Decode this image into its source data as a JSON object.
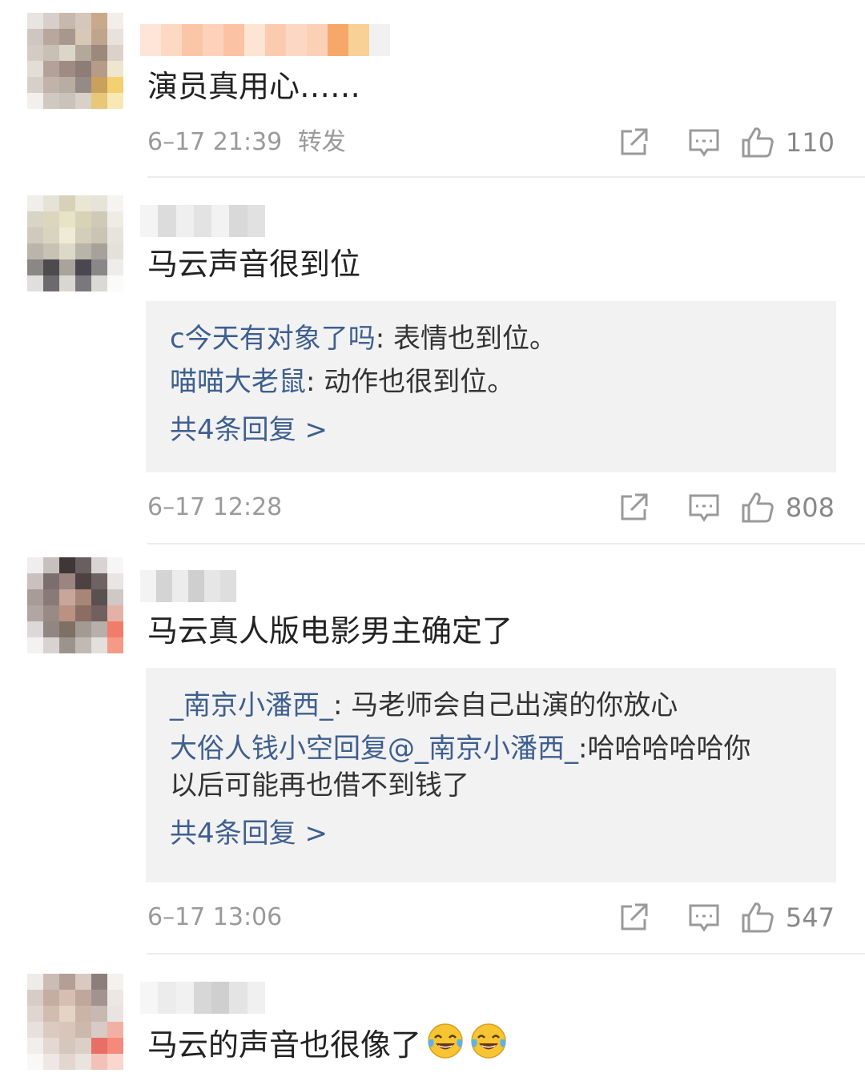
{
  "comments": [
    {
      "text": "演员真用心……",
      "time": "6–17 21:39",
      "extra": "转发",
      "likes": "110",
      "replies": null
    },
    {
      "text": "马云声音很到位",
      "time": "6–17 12:28",
      "likes": "808",
      "replies": {
        "items": [
          {
            "user": "c今天有对象了吗",
            "sep": ": ",
            "text": "表情也到位。"
          },
          {
            "user": "喵喵大老鼠",
            "sep": ": ",
            "text": "动作也很到位。"
          }
        ],
        "more": "共4条回复 >"
      }
    },
    {
      "text": "马云真人版电影男主确定了",
      "time": "6–17 13:06",
      "likes": "547",
      "replies": {
        "items": [
          {
            "user": "_南京小潘西_",
            "sep": ": ",
            "text": "马老师会自己出演的你放心"
          },
          {
            "user": "大俗人钱小空回复@_南京小潘西_",
            "sep": ":",
            "text": "哈哈哈哈哈你",
            "text2": "以后可能再也借不到钱了"
          }
        ],
        "more": "共4条回复 >"
      }
    },
    {
      "text": "马云的声音也很像了",
      "emoji": "tears-of-joy-emoji"
    }
  ],
  "colors": {
    "link": "#3e5f8f",
    "meta": "#9a9a9a",
    "reply_bg": "#f2f2f2",
    "icon": "#9a9a9a"
  },
  "icons": [
    "share-icon",
    "comment-icon",
    "like-icon"
  ]
}
